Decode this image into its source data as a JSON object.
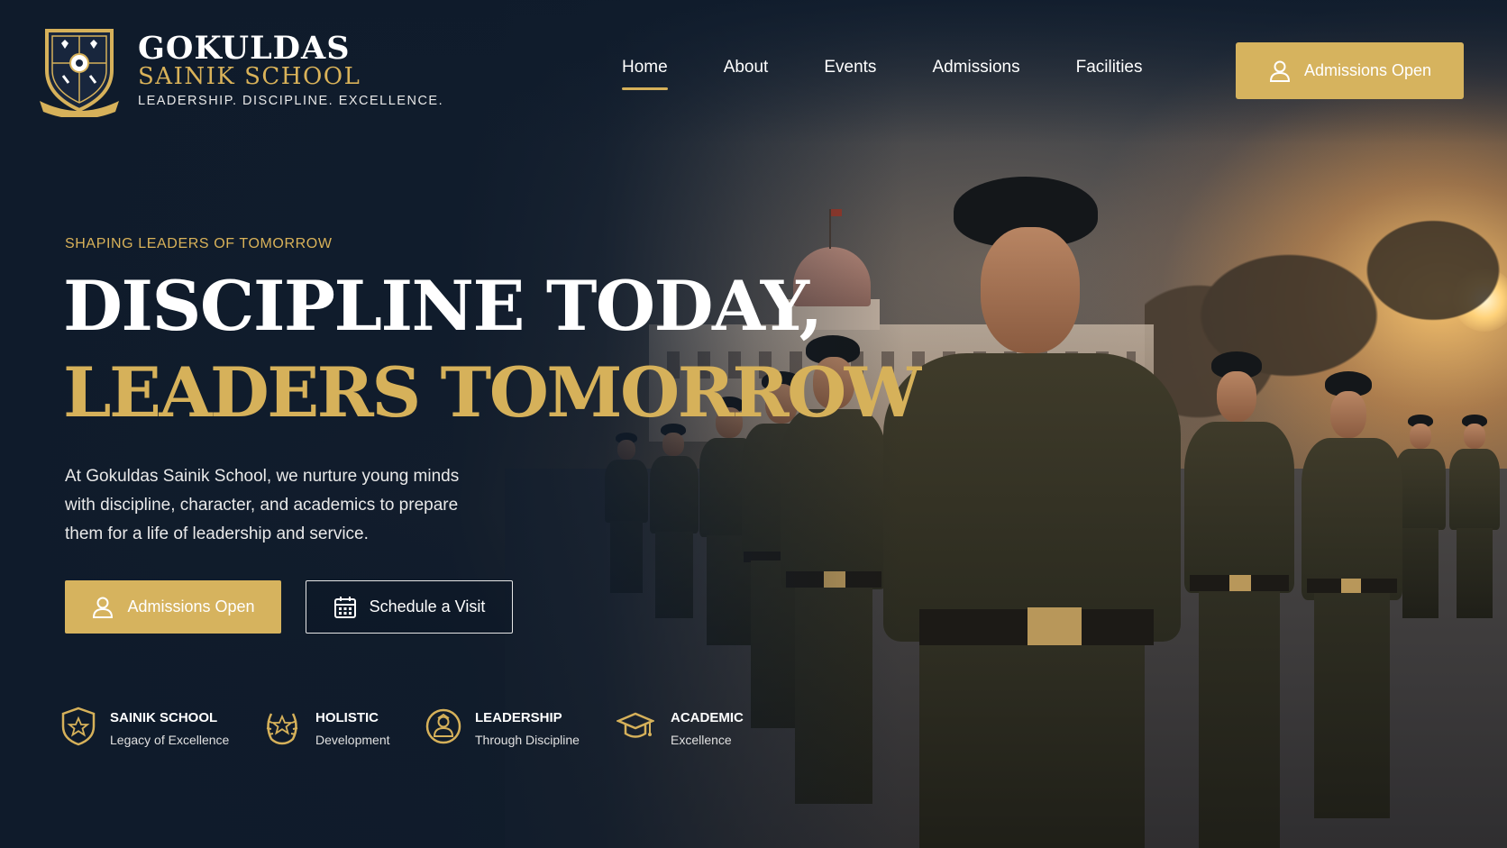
{
  "brand": {
    "name": "GOKULDAS",
    "sub": "SAINIK SCHOOL",
    "tagline": "LEADERSHIP. DISCIPLINE. EXCELLENCE."
  },
  "nav": {
    "items": [
      {
        "label": "Home",
        "active": true
      },
      {
        "label": "About",
        "active": false
      },
      {
        "label": "Events",
        "active": false
      },
      {
        "label": "Admissions",
        "active": false
      },
      {
        "label": "Facilities",
        "active": false
      }
    ],
    "cta_label": "Admissions Open"
  },
  "hero": {
    "eyebrow": "SHAPING LEADERS OF TOMORROW",
    "headline_1": "DISCIPLINE TODAY,",
    "headline_2": "LEADERS TOMORROW",
    "description": "At Gokuldas Sainik School, we nurture young minds with discipline, character, and academics to prepare them for a life of leadership and service.",
    "primary_label": "Admissions Open",
    "secondary_label": "Schedule a Visit"
  },
  "features": [
    {
      "title": "SAINIK SCHOOL",
      "subtitle": "Legacy of Excellence",
      "icon": "shield-star-icon"
    },
    {
      "title": "HOLISTIC",
      "subtitle": "Development",
      "icon": "laurel-star-icon"
    },
    {
      "title": "LEADERSHIP",
      "subtitle": "Through Discipline",
      "icon": "person-badge-icon"
    },
    {
      "title": "ACADEMIC",
      "subtitle": "Excellence",
      "icon": "graduation-cap-icon"
    }
  ],
  "colors": {
    "accent": "#d6b35e",
    "navy": "#0f1b2b",
    "text": "#ffffff"
  }
}
